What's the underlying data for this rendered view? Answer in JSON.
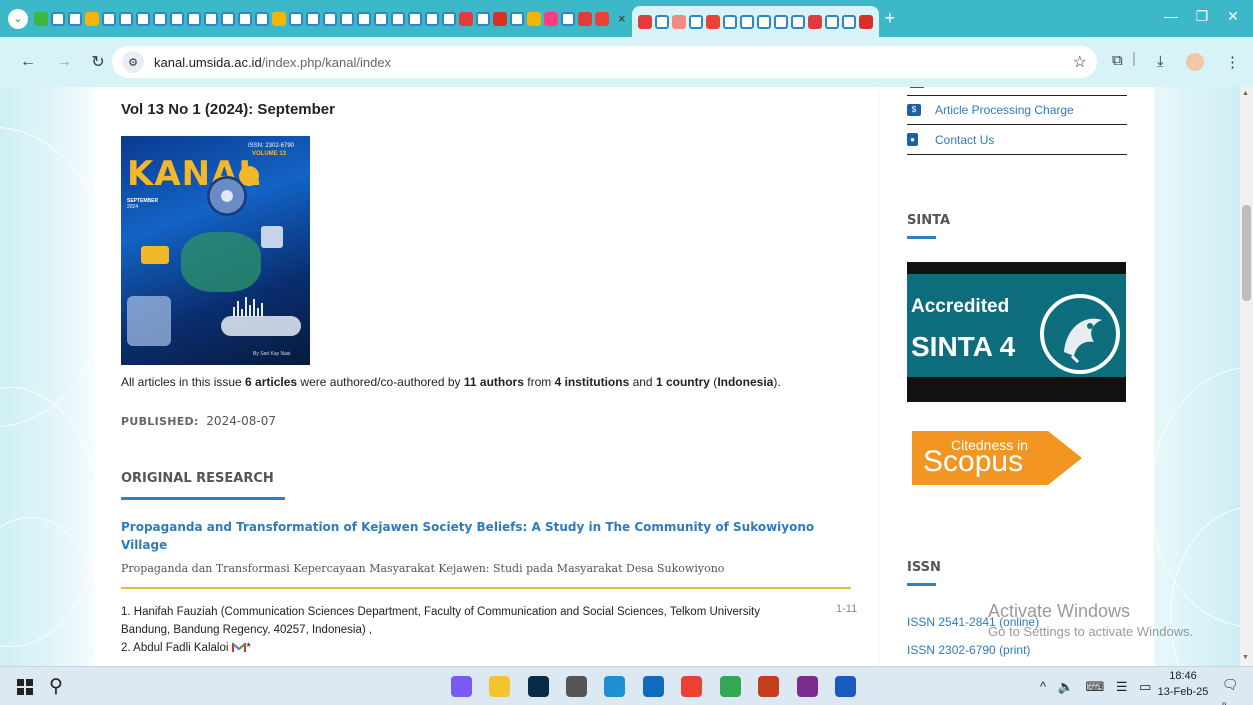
{
  "browser": {
    "active_tab_close": "×",
    "new_tab": "+",
    "tab_menu": "⌄",
    "window_controls": [
      "—",
      "❐",
      "✕"
    ],
    "url_host": "kanal.umsida.ac.id",
    "url_path": "/index.php/kanal/index",
    "tab_icon_colors": [
      "#3bb544",
      "#ffffff",
      "#ffffff",
      "#f4b400",
      "#ffffff",
      "#ffffff",
      "#ffffff",
      "#ffffff",
      "#ffffff",
      "#ffffff",
      "#ffffff",
      "#ffffff",
      "#ffffff",
      "#ffffff",
      "#f4b400",
      "#ffffff",
      "#ffffff",
      "#ffffff",
      "#ffffff",
      "#ffffff",
      "#ffffff",
      "#ffffff",
      "#ffffff",
      "#ffffff",
      "#ffffff",
      "#e23b3b",
      "#ffffff",
      "#d93025",
      "#ffffff",
      "#f4b400",
      "#ff3d7f",
      "#ffffff",
      "#e23b3b",
      "#ea4335"
    ],
    "active_tab_icon_colors": [
      "#e23b3b",
      "#ffffff",
      "#f28b82",
      "#ffffff",
      "#ea4335",
      "#ffffff",
      "#ffffff",
      "#ffffff",
      "#ffffff",
      "#ffffff",
      "#e23b3b",
      "#ffffff",
      "#ffffff",
      "#d93025"
    ],
    "accent": "#3cb8c8"
  },
  "issue": {
    "title": "Vol 13 No 1 (2024): September",
    "cover": {
      "brand": "KANAL",
      "issn": "ISSN: 2302-6790",
      "volume": "VOLUME 13",
      "month": "SEPTEMBER",
      "year": "2024",
      "tagline": "By Sari Kay Nasi"
    },
    "summary": {
      "t1": "All articles in this issue ",
      "b1": "6 articles",
      "t2": " were authored/co-authored by ",
      "b2": "11 authors",
      "t3": " from ",
      "b3": "4 institutions",
      "t4": " and ",
      "b4": "1 country",
      "t5": " (",
      "b5": "Indonesia",
      "t6": ")."
    },
    "published_label": "PUBLISHED:",
    "published_date": "2024-08-07",
    "section": "ORIGINAL RESEARCH",
    "article": {
      "title": "Propaganda and Transformation of Kejawen Society Beliefs: A Study in The Community of Sukowiyono Village",
      "subtitle": "Propaganda dan Transformasi Kepercayaan Masyarakat Kejawen: Studi pada Masyarakat Desa Sukowiyono",
      "author1": "1. Hanifah Fauziah (Communication Sciences Department, Faculty of Communication and Social Sciences, Telkom University Bandung, Bandung Regency, 40257, Indonesia) ,",
      "author2": "2. Abdul Fadli Kalaloi",
      "author2_mark": "*",
      "pages": "1-11"
    }
  },
  "sidebar": {
    "menu": [
      {
        "label": "Article Processing Charge",
        "icon": "money-icon"
      },
      {
        "label": "Contact Us",
        "icon": "contact-icon"
      }
    ],
    "sinta_heading": "SINTA",
    "sinta_badge": {
      "accredited": "Accredited",
      "grade": "SINTA 4"
    },
    "scopus_badge": {
      "small": "Citedness in",
      "big": "Scopus"
    },
    "issn_heading": "ISSN",
    "issn_online": "ISSN 2541-2841 (online)",
    "issn_print": "ISSN 2302-6790 (print)"
  },
  "watermark": {
    "title": "Activate Windows",
    "subtitle": "Go to Settings to activate Windows."
  },
  "taskbar": {
    "apps": [
      {
        "name": "copilot-icon",
        "color": "#7a5af5"
      },
      {
        "name": "file-explorer-icon",
        "color": "#f4c430"
      },
      {
        "name": "photoshop-icon",
        "color": "#0a2a4a"
      },
      {
        "name": "settings-icon",
        "color": "#555555"
      },
      {
        "name": "edge-icon",
        "color": "#1f8fd1"
      },
      {
        "name": "outlook-icon",
        "color": "#0f6cbd"
      },
      {
        "name": "chrome-icon",
        "color": "#e94235"
      },
      {
        "name": "chrome-profile-icon",
        "color": "#34a853"
      },
      {
        "name": "powerpoint-icon",
        "color": "#c43e1c"
      },
      {
        "name": "winrar-icon",
        "color": "#7b2c8f"
      },
      {
        "name": "word-icon",
        "color": "#185abd"
      }
    ],
    "tray": "^ 🔈 ⌨ ☰ ▭",
    "time": "18:46",
    "date": "13-Feb-25",
    "notification_count": "8"
  }
}
